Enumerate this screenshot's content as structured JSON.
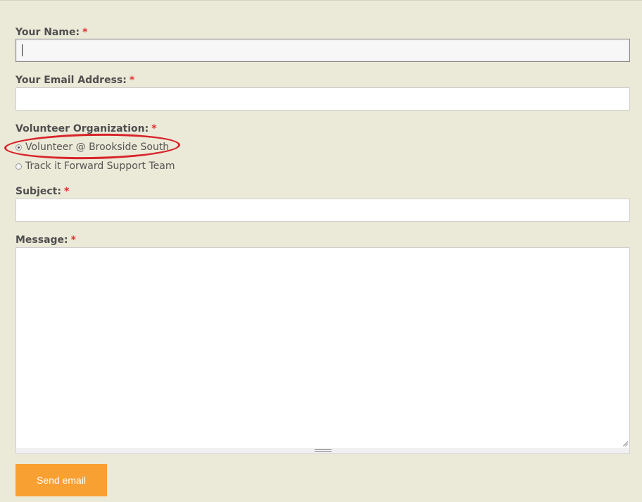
{
  "form": {
    "name": {
      "label": "Your Name:",
      "required_mark": "*",
      "value": ""
    },
    "email": {
      "label": "Your Email Address:",
      "required_mark": "*",
      "value": ""
    },
    "organization": {
      "label": "Volunteer Organization:",
      "required_mark": "*",
      "options": [
        {
          "label": "Volunteer @ Brookside South",
          "checked": true
        },
        {
          "label": "Track it Forward Support Team",
          "checked": false
        }
      ]
    },
    "subject": {
      "label": "Subject:",
      "required_mark": "*",
      "value": ""
    },
    "message": {
      "label": "Message:",
      "required_mark": "*",
      "value": ""
    },
    "submit_label": "Send email"
  },
  "colors": {
    "background": "#ebe9d7",
    "required": "#e03030",
    "button": "#f9a033",
    "annotation": "#d8232a"
  }
}
